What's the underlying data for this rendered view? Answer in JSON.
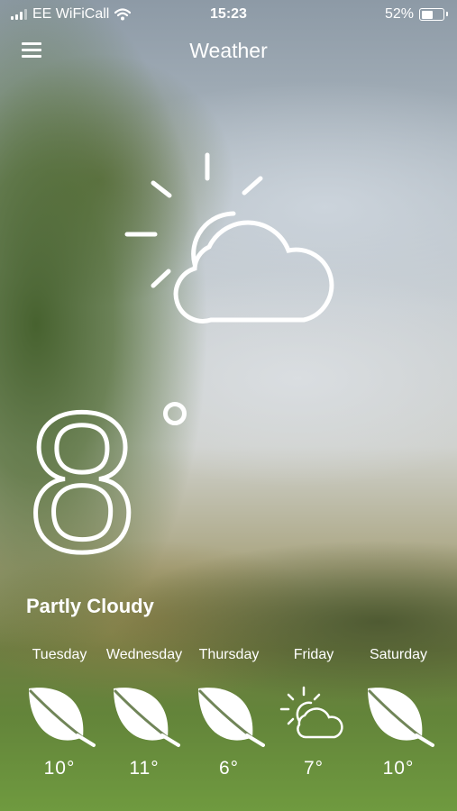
{
  "status_bar": {
    "carrier": "EE WiFiCall",
    "time": "15:23",
    "battery_text": "52%",
    "battery_level": 0.52,
    "signal_bars": 3,
    "icons": [
      "signal-icon",
      "wifi-icon",
      "battery-icon"
    ]
  },
  "nav": {
    "title": "Weather",
    "menu_icon": "hamburger-menu-icon"
  },
  "current": {
    "temperature": "8",
    "degree_symbol": "°",
    "condition": "Partly Cloudy",
    "icon": "partly-cloudy-icon"
  },
  "forecast": [
    {
      "day": "Tuesday",
      "temp": "10°",
      "icon": "leaf-icon"
    },
    {
      "day": "Wednesday",
      "temp": "11°",
      "icon": "leaf-icon"
    },
    {
      "day": "Thursday",
      "temp": "6°",
      "icon": "leaf-icon"
    },
    {
      "day": "Friday",
      "temp": "7°",
      "icon": "partly-cloudy-icon"
    },
    {
      "day": "Saturday",
      "temp": "10°",
      "icon": "leaf-icon"
    }
  ]
}
